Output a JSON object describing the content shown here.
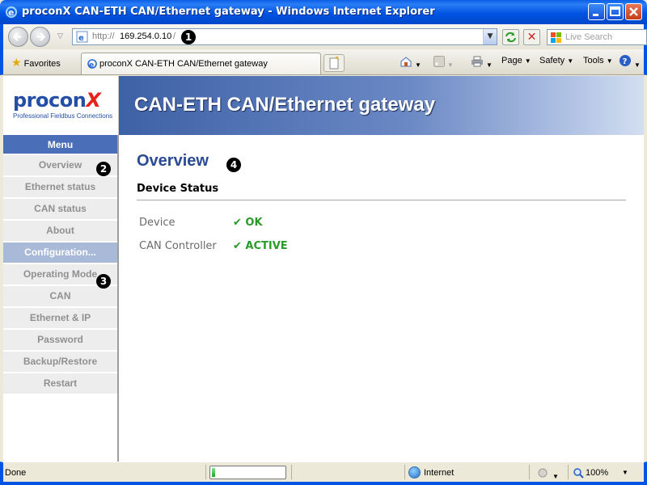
{
  "window": {
    "title": "proconX CAN-ETH CAN/Ethernet gateway - Windows Internet Explorer"
  },
  "address_bar": {
    "protocol": "http://",
    "host": "169.254.0.10",
    "trailing": "/",
    "search_placeholder": "Live Search"
  },
  "toolbar": {
    "favorites_label": "Favorites",
    "tab_title": "proconX CAN-ETH CAN/Ethernet gateway",
    "page_label": "Page",
    "safety_label": "Safety",
    "tools_label": "Tools"
  },
  "markers": [
    "1",
    "2",
    "3",
    "4"
  ],
  "header": {
    "logo_text": "procon",
    "logo_x": "X",
    "logo_tagline": "Professional Fieldbus Connections",
    "banner_title": "CAN-ETH CAN/Ethernet gateway"
  },
  "sidebar": {
    "menu_title": "Menu",
    "items": [
      {
        "label": "Overview"
      },
      {
        "label": "Ethernet status"
      },
      {
        "label": "CAN status"
      },
      {
        "label": "About"
      }
    ],
    "config_title": "Configuration...",
    "config_items": [
      {
        "label": "Operating Mode"
      },
      {
        "label": "CAN"
      },
      {
        "label": "Ethernet & IP"
      },
      {
        "label": "Password"
      },
      {
        "label": "Backup/Restore"
      },
      {
        "label": "Restart"
      }
    ]
  },
  "main": {
    "page_title": "Overview",
    "section_title": "Device Status",
    "rows": [
      {
        "label": "Device",
        "value": "✔ OK"
      },
      {
        "label": "CAN Controller",
        "value": "✔ ACTIVE"
      }
    ]
  },
  "statusbar": {
    "status_text": "Done",
    "progress_fraction": 0.05,
    "zone": "Internet",
    "zoom": "100%"
  },
  "colors": {
    "banner_blue": "#3e61a6",
    "heading_blue": "#2a4a94",
    "ok_green": "#2a9a2a",
    "menu_header": "#4a6eb8",
    "config_header": "#a9bad8"
  }
}
